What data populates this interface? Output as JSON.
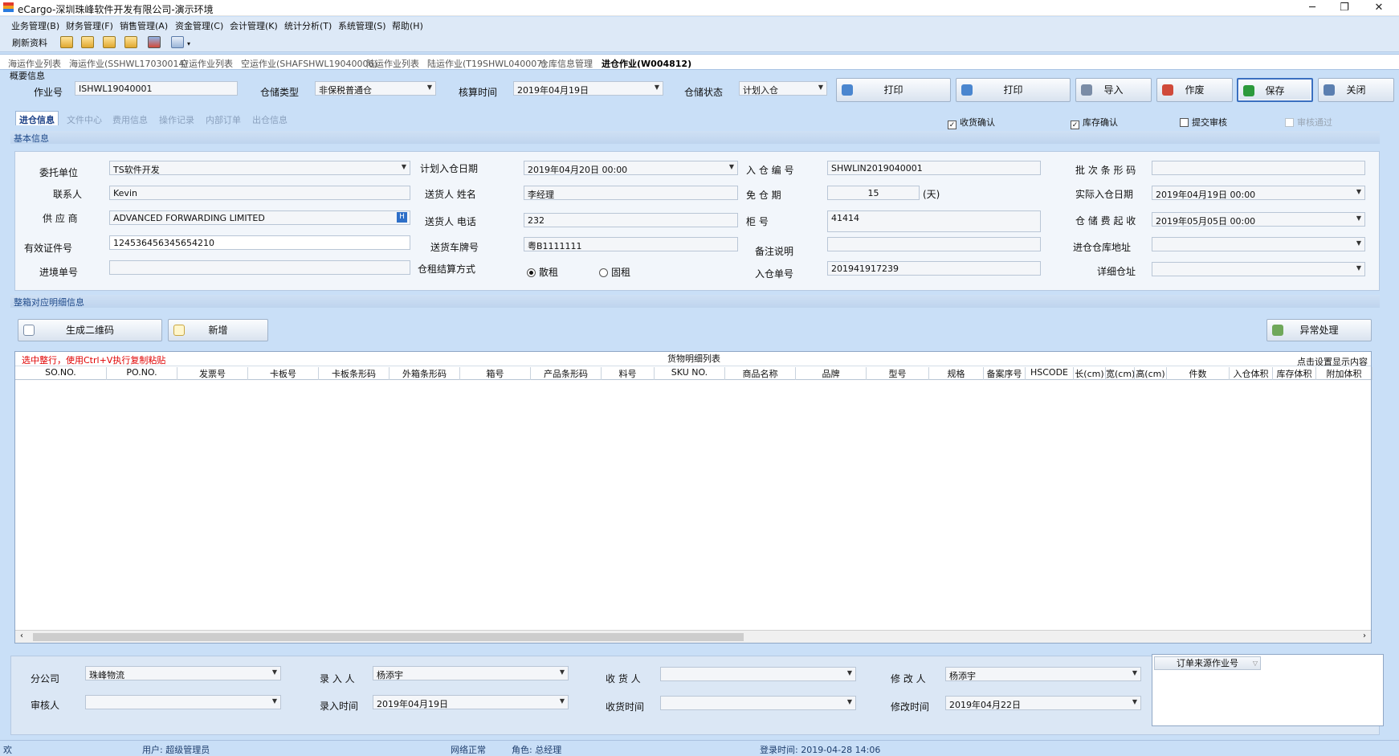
{
  "window": {
    "title": "eCargo-深圳珠峰软件开发有限公司-演示环境",
    "min": "─",
    "restore": "❐",
    "close": "✕"
  },
  "menu": [
    "业务管理(B)",
    "财务管理(F)",
    "销售管理(A)",
    "资金管理(C)",
    "会计管理(K)",
    "统计分析(T)",
    "系统管理(S)",
    "帮助(H)"
  ],
  "toolbar": {
    "refresh": "刷新资料"
  },
  "doc_tabs": [
    "海运作业列表",
    "海运作业(SSHWL17030014)",
    "空运作业列表",
    "空运作业(SHAFSHWL19040006)",
    "陆运作业列表",
    "陆运作业(T19SHWL040007)",
    "仓库信息管理",
    "进仓作业(W004812)"
  ],
  "overview": {
    "title": "概要信息",
    "job_no_label": "作业号",
    "job_no": "ISHWL19040001",
    "type_label": "仓储类型",
    "type": "非保税普通仓",
    "calc_label": "核算时间",
    "calc": "2019年04月19日",
    "status_label": "仓储状态",
    "status": "计划入仓"
  },
  "actions": {
    "print1": "打印",
    "print2": "打印",
    "import": "导入",
    "void": "作废",
    "save": "保存",
    "close": "关闭"
  },
  "panel_tabs": [
    "进仓信息",
    "文件中心",
    "费用信息",
    "操作记录",
    "内部订单",
    "出仓信息"
  ],
  "checks": {
    "receipt": "收货确认",
    "stock": "库存确认",
    "submit": "提交审核",
    "approved": "审核通过"
  },
  "basic": {
    "title": "基本信息",
    "client_label": "委托单位",
    "client": "TS软件开发",
    "contact_label": "联系人",
    "contact": "Kevin",
    "supplier_label": "供 应 商",
    "supplier": "ADVANCED FORWARDING LIMITED",
    "cert_label": "有效证件号",
    "cert": "124536456345654210",
    "entry_label": "进境单号",
    "entry": "",
    "plan_date_label": "计划入仓日期",
    "plan_date": "2019年04月20日 00:00",
    "sender_label": "送货人 姓名",
    "sender": "李经理",
    "sender_tel_label": "送货人 电话",
    "sender_tel": "232",
    "plate_label": "送货车牌号",
    "plate": "粤B1111111",
    "rent_label": "仓租结算方式",
    "rent_opt1": "散租",
    "rent_opt2": "固租",
    "in_no_label": "入 仓 编 号",
    "in_no": "SHWLIN2019040001",
    "free_label": "免  仓  期",
    "free": "15",
    "free_unit": "(天)",
    "cabinet_label": "柜       号",
    "cabinet": "41414",
    "remark_label": "备注说明",
    "remark": "",
    "in_bill_label": "入仓单号",
    "in_bill": "201941917239",
    "batch_label": "批 次 条 形 码",
    "batch": "",
    "actual_label": "实际入仓日期",
    "actual": "2019年04月19日 00:00",
    "fee_label": "仓 储 费 起 收",
    "fee": "2019年05月05日 00:00",
    "wh_addr_label": "进仓仓库地址",
    "wh_addr": "",
    "detail_addr_label": "详细仓址",
    "detail_addr": ""
  },
  "detail": {
    "title": "整箱对应明细信息",
    "qr": "生成二维码",
    "add": "新增",
    "exception": "异常处理",
    "hint": "选中整行，使用Ctrl+V执行复制粘贴",
    "grid_title": "货物明细列表",
    "settings": "点击设置显示内容",
    "columns": [
      "SO.NO.",
      "PO.NO.",
      "发票号",
      "卡板号",
      "卡板条形码",
      "外箱条形码",
      "箱号",
      "产品条形码",
      "料号",
      "SKU NO.",
      "商品名称",
      "品牌",
      "型号",
      "规格",
      "备案序号",
      "HSCODE",
      "长(cm)",
      "宽(cm)",
      "高(cm)",
      "件数",
      "入仓体积",
      "库存体积",
      "附加体积"
    ]
  },
  "footer": {
    "branch_label": "分公司",
    "branch": "珠峰物流",
    "reviewer_label": "审核人",
    "reviewer": "",
    "creator_label": "录  入  人",
    "creator": "杨添宇",
    "created_label": "录入时间",
    "created": "2019年04月19日",
    "consignee_label": "收  货  人",
    "consignee": "",
    "received_label": "收货时间",
    "received": "",
    "modifier_label": "修  改  人",
    "modifier": "杨添宇",
    "modified_label": "修改时间",
    "modified": "2019年04月22日",
    "source_label": "订单来源作业号"
  },
  "status": {
    "welcome": "欢",
    "user": "用户: 超级管理员",
    "network": "网络正常",
    "role": "角色: 总经理",
    "login": "登录时间: 2019-04-28 14:06"
  }
}
